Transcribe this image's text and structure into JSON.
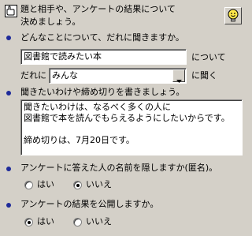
{
  "header": {
    "line1": "題と相手や、アンケートの結果について",
    "line2": "決めましょう。",
    "hand_icon": "pointing-hand-icon",
    "bulb_icon": "light-bulb-icon"
  },
  "q1": {
    "label": "どんなことについて、だれに聞きますか。",
    "topic_value": "図書館で読みたい本",
    "topic_suffix": "について",
    "target_prefix": "だれに",
    "target_value": "みんな",
    "target_suffix": "に聞く"
  },
  "q2": {
    "label": "聞きたいわけや締め切りを書きましょう。",
    "line1": "聞きたいわけは、なるべく多くの人に",
    "line2": "図書館で本を読んでもらえるようにしたいからです。",
    "line3": "締め切りは、7月20日です。"
  },
  "q3": {
    "label": "アンケートに答えた人の名前を隠しますか(匿名)。",
    "yes": "はい",
    "no": "いいえ",
    "selected": "いいえ"
  },
  "q4": {
    "label": "アンケートの結果を公開しますか。",
    "yes": "はい",
    "no": "いいえ",
    "selected": "はい"
  },
  "colors": {
    "background": "#d4d0c8",
    "bullet": "#1e2a9a",
    "bulb": "#ffe84a"
  }
}
